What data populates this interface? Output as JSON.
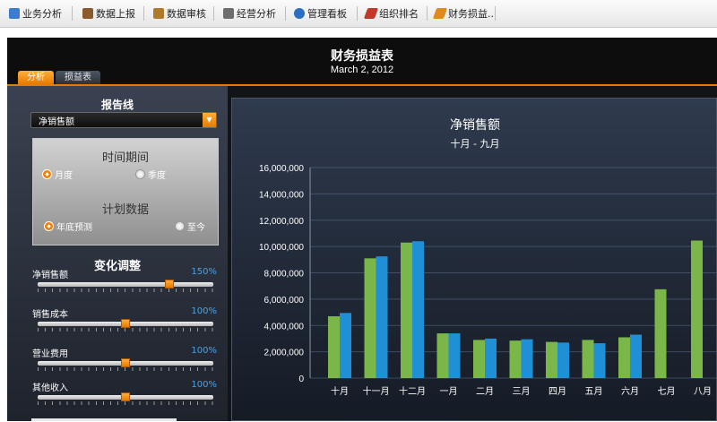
{
  "toolbar": {
    "items": [
      {
        "label": "业务分析",
        "icon": "grid-icon",
        "color": "#3b7bd1"
      },
      {
        "label": "数据上报",
        "icon": "book-icon",
        "color": "#8a5a2b"
      },
      {
        "label": "数据审核",
        "icon": "clipboard-icon",
        "color": "#b07a2a"
      },
      {
        "label": "经营分析",
        "icon": "calculator-icon",
        "color": "#6d6d6d"
      },
      {
        "label": "管理看板",
        "icon": "p-icon",
        "color": "#2a6fc4"
      },
      {
        "label": "组织排名",
        "icon": "pencil-icon",
        "color": "#c0392b"
      },
      {
        "label": "财务损益..",
        "icon": "pencil-icon",
        "color": "#e08a1e"
      }
    ]
  },
  "dashboard": {
    "title": "财务损益表",
    "date": "March 2, 2012",
    "tabs": [
      {
        "label": "分析",
        "active": true
      },
      {
        "label": "损益表",
        "active": false
      }
    ]
  },
  "report_line": {
    "label": "报告线",
    "selected": "净销售额"
  },
  "time_period": {
    "title": "时间期间",
    "options": [
      {
        "label": "月度",
        "selected": true
      },
      {
        "label": "季度",
        "selected": false
      }
    ]
  },
  "plan_data": {
    "title": "计划数据",
    "options": [
      {
        "label": "年底预测",
        "selected": true
      },
      {
        "label": "至今",
        "selected": false
      }
    ]
  },
  "adjustments": {
    "title": "变化调整",
    "sliders": [
      {
        "label": "净销售额",
        "value": "150%",
        "fraction": 0.75
      },
      {
        "label": "销售成本",
        "value": "100%",
        "fraction": 0.5
      },
      {
        "label": "营业费用",
        "value": "100%",
        "fraction": 0.5
      },
      {
        "label": "其他收入",
        "value": "100%",
        "fraction": 0.5
      }
    ]
  },
  "colors": {
    "accent": "#f47f00",
    "series_green": "#7ab648",
    "series_blue": "#1f8fd6",
    "percent_text": "#4aa3e8"
  },
  "chart_data": {
    "type": "bar",
    "title": "净销售额",
    "subtitle": "十月 - 九月",
    "categories": [
      "十月",
      "十一月",
      "十二月",
      "一月",
      "二月",
      "三月",
      "四月",
      "五月",
      "六月",
      "七月",
      "八月"
    ],
    "series": [
      {
        "color": "#7ab648",
        "values": [
          4700000,
          9100000,
          10300000,
          3400000,
          2900000,
          2850000,
          2750000,
          2900000,
          3100000,
          6750000,
          10450000
        ]
      },
      {
        "color": "#1f8fd6",
        "values": [
          4950000,
          9250000,
          10400000,
          3400000,
          3000000,
          2950000,
          2700000,
          2650000,
          3300000,
          null,
          null
        ]
      }
    ],
    "yticks": [
      "0",
      "2,000,000",
      "4,000,000",
      "6,000,000",
      "8,000,000",
      "10,000,000",
      "12,000,000",
      "14,000,000",
      "16,000,000"
    ],
    "ylim": [
      0,
      16000000
    ],
    "grid": true
  }
}
